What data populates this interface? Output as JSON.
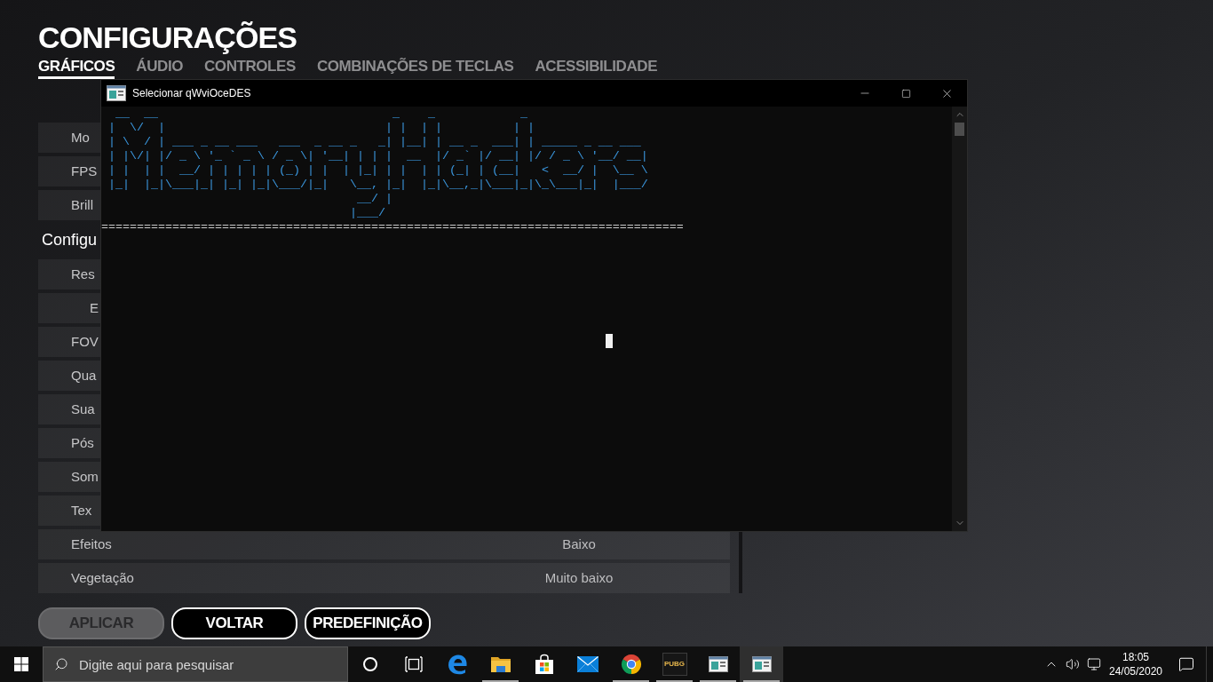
{
  "game": {
    "title": "CONFIGURAÇÕES",
    "tabs": [
      {
        "label": "GRÁFICOS",
        "selected": true
      },
      {
        "label": "ÁUDIO",
        "selected": false
      },
      {
        "label": "CONTROLES",
        "selected": false
      },
      {
        "label": "COMBINAÇÕES DE TECLAS",
        "selected": false
      },
      {
        "label": "ACESSIBILIDADE",
        "selected": false
      }
    ],
    "settings": [
      {
        "kind": "setting",
        "label": "Mo"
      },
      {
        "kind": "setting",
        "label": "FPS"
      },
      {
        "kind": "setting",
        "label": "Brill"
      },
      {
        "kind": "section",
        "label": "Configu"
      },
      {
        "kind": "setting",
        "label": "Res"
      },
      {
        "kind": "subsetting",
        "label": "E"
      },
      {
        "kind": "setting",
        "label": "FOV"
      },
      {
        "kind": "setting",
        "label": "Qua"
      },
      {
        "kind": "setting",
        "label": "Sua"
      },
      {
        "kind": "setting",
        "label": "Pós"
      },
      {
        "kind": "setting",
        "label": "Som"
      },
      {
        "kind": "setting",
        "label": "Tex"
      },
      {
        "kind": "setting",
        "label": "Efeitos",
        "value": "Baixo"
      },
      {
        "kind": "setting",
        "label": "Vegetação",
        "value": "Muito baixo"
      }
    ],
    "buttons": [
      {
        "label": "APLICAR",
        "disabled": true
      },
      {
        "label": "VOLTAR",
        "disabled": false
      },
      {
        "label": "PREDEFINIÇÃO",
        "disabled": false
      }
    ]
  },
  "console_window": {
    "title": "Selecionar qWviOceDES",
    "banner_lines": [
      "  __  __                                 _    _            _",
      " |  \\/  |                               | |  | |          | |",
      " | \\  / | ___ _ __ ___   ___  _ __ _   _| |__| | __ _  ___| | _____ _ __ ___",
      " | |\\/| |/ _ \\ '_ ` _ \\ / _ \\| '__| | | |  __  |/ _` |/ __| |/ / _ \\ '__/ __|",
      " | |  | |  __/ | | | | | (_) | |  | |_| | |  | | (_| | (__|   <  __/ |  \\__ \\",
      " |_|  |_|\\___|_| |_| |_|\\___/|_|   \\__, |_|  |_|\\__,_|\\___|_|\\_\\___|_|  |___/",
      "                                    __/ |",
      "                                   |___/"
    ],
    "separator": "=================================================================================="
  },
  "taskbar": {
    "search": {
      "placeholder": "Digite aqui para pesquisar"
    },
    "apps": [
      {
        "kind": "edge",
        "running": false,
        "active": false
      },
      {
        "kind": "explorer",
        "running": true,
        "active": false
      },
      {
        "kind": "store",
        "running": false,
        "active": false
      },
      {
        "kind": "mail",
        "running": false,
        "active": false
      },
      {
        "kind": "chrome",
        "running": true,
        "active": false
      },
      {
        "kind": "game",
        "label": "PUBG",
        "running": true,
        "active": false
      },
      {
        "kind": "console",
        "running": true,
        "active": false
      },
      {
        "kind": "console",
        "running": true,
        "active": true
      }
    ],
    "clock": {
      "time": "18:05",
      "date": "24/05/2020"
    }
  }
}
